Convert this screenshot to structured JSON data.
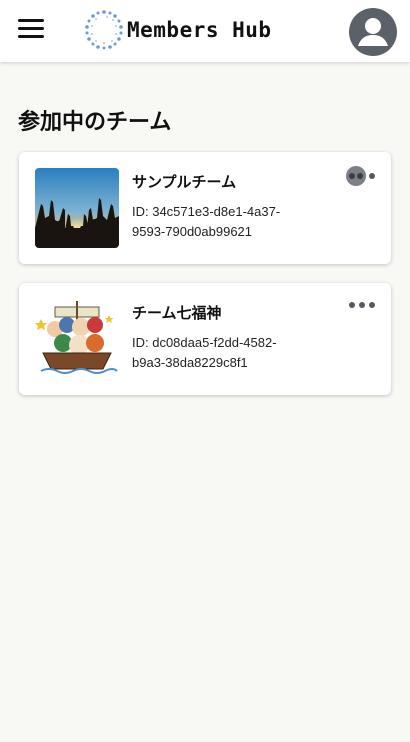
{
  "header": {
    "brand": "Members Hub",
    "menu_icon": "hamburger-menu-icon",
    "logo_icon": "circular-dots-logo",
    "avatar_icon": "user-avatar-icon"
  },
  "page": {
    "title": "参加中のチーム"
  },
  "teams": [
    {
      "name": "サンプルチーム",
      "id_line1": "ID: 34c571e3-d8e1-4a37-",
      "id_line2": "9593-790d0ab99621",
      "thumbnail": "crowd-at-sunset-image",
      "more_icon": "more-options-icon"
    },
    {
      "name": "チーム七福神",
      "id_line1": "ID: dc08daa5-f2dd-4582-",
      "id_line2": "b9a3-38da8229c8f1",
      "thumbnail": "seven-lucky-gods-boat-illustration",
      "more_icon": "more-options-icon"
    }
  ],
  "colors": {
    "background": "#f8f8f5",
    "header": "#ffffff",
    "avatar": "#5b6168",
    "logo_dots": "#6b9bd6",
    "more_icon": "#555a62"
  }
}
